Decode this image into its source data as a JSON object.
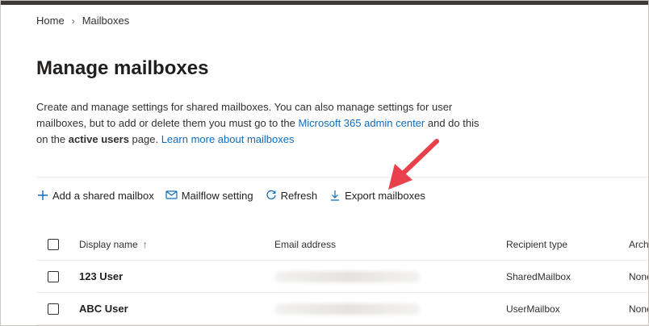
{
  "breadcrumb": {
    "home": "Home",
    "current": "Mailboxes"
  },
  "page": {
    "title": "Manage mailboxes",
    "desc_part1": "Create and manage settings for shared mailboxes. You can also manage settings for user mailboxes, but to add or delete them you must go to the ",
    "desc_link1": "Microsoft 365 admin center",
    "desc_part2": " and do this on the ",
    "desc_bold": "active users",
    "desc_part3": " page. ",
    "desc_link2": "Learn more about mailboxes"
  },
  "toolbar": {
    "add": "Add a shared mailbox",
    "mailflow": "Mailflow setting",
    "refresh": "Refresh",
    "export": "Export mailboxes"
  },
  "table": {
    "headers": {
      "name": "Display name",
      "sort": "↑",
      "email": "Email address",
      "type": "Recipient type",
      "arch": "Arch"
    },
    "rows": [
      {
        "name": "123 User",
        "type": "SharedMailbox",
        "arch": "None"
      },
      {
        "name": "ABC User",
        "type": "UserMailbox",
        "arch": "None"
      }
    ]
  },
  "colors": {
    "link": "#0f6cbd",
    "arrow": "#e8414b",
    "topbar": "#3b3a39"
  }
}
